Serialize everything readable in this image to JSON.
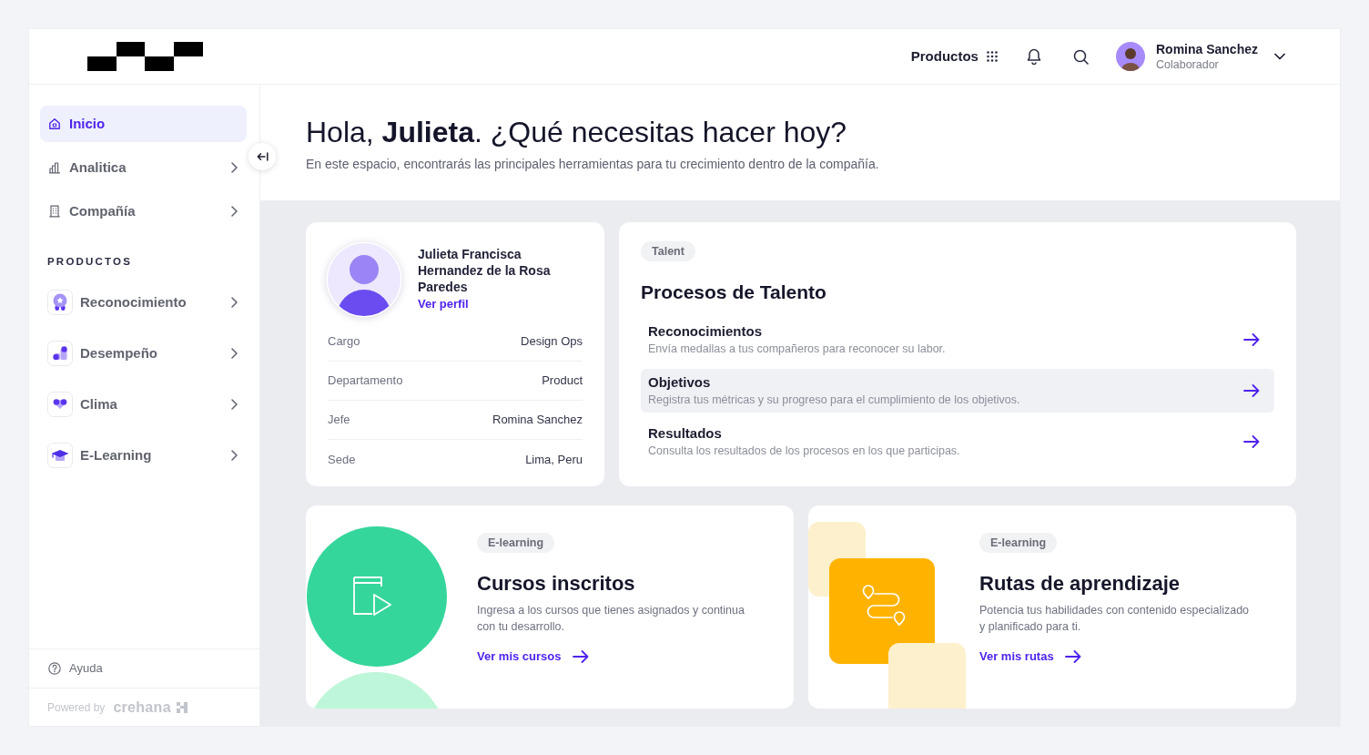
{
  "header": {
    "products_menu": "Productos",
    "user": {
      "name": "Romina Sanchez",
      "role": "Colaborador"
    }
  },
  "sidebar": {
    "items": [
      {
        "label": "Inicio",
        "selected": true,
        "expandable": false
      },
      {
        "label": "Analitica",
        "selected": false,
        "expandable": true
      },
      {
        "label": "Compañía",
        "selected": false,
        "expandable": true
      }
    ],
    "products_title": "PRODUCTOS",
    "products": [
      {
        "label": "Reconocimiento",
        "selected": false,
        "expandable": true
      },
      {
        "label": "Desempeño",
        "selected": false,
        "expandable": true
      },
      {
        "label": "Clima",
        "selected": false,
        "expandable": true
      },
      {
        "label": "E-Learning",
        "selected": false,
        "expandable": true
      }
    ],
    "help": "Ayuda",
    "powered_by": "Powered by",
    "brand": "crehana"
  },
  "greeting": {
    "title": "Hola, **Julieta**. ¿Qué necesitas hacer hoy?",
    "subtitle": "En este espacio, encontrarás las principales herramientas para tu crecimiento dentro de la compañía."
  },
  "profile": {
    "name": "Julieta Francisca Hernandez de la Rosa Paredes",
    "link": "Ver perfil",
    "fields": [
      {
        "label": "Cargo",
        "value": "Design Ops"
      },
      {
        "label": "Departamento",
        "value": "Product"
      },
      {
        "label": "Jefe",
        "value": "Romina Sanchez"
      },
      {
        "label": "Sede",
        "value": "Lima, Peru"
      }
    ]
  },
  "talent": {
    "tag": "Talent",
    "title": "Procesos de Talento",
    "items": [
      {
        "title": "Reconocimientos",
        "description": "Envía medallas a tus compañeros para reconocer su labor.",
        "highlighted": false
      },
      {
        "title": "Objetivos",
        "description": "Registra tus métricas y su progreso para el cumplimiento de los objetivos.",
        "highlighted": true
      },
      {
        "title": "Resultados",
        "description": "Consulta los resultados de los procesos en los que participas.",
        "highlighted": false
      }
    ]
  },
  "promos": [
    {
      "kind": "courses",
      "tag": "E-learning",
      "title": "Cursos inscritos",
      "description": "Ingresa a los cursos que tienes asignados y continua con tu desarrollo.",
      "link": "Ver mis cursos"
    },
    {
      "kind": "paths",
      "tag": "E-learning",
      "title": "Rutas de aprendizaje",
      "description": "Potencia tus habilidades con contenido especializado y planificado para ti.",
      "link": "Ver mis rutas"
    }
  ]
}
